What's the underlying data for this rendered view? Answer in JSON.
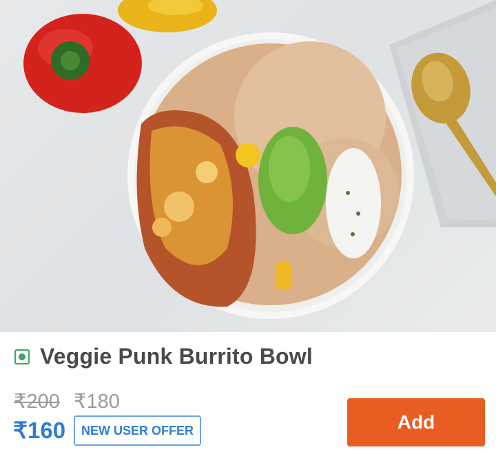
{
  "product": {
    "image_alt": "burrito-bowl-photo",
    "veg_indicator_color": "#3aa66a",
    "name": "Veggie Punk Burrito Bowl",
    "original_price": "₹200",
    "discounted_price": "₹180",
    "offer_price": "₹160",
    "offer_badge": "NEW USER OFFER",
    "add_label": "Add"
  },
  "colors": {
    "accent": "#ea5d22",
    "offer_blue": "#2f7dd6",
    "title": "#4a4a4a",
    "muted": "#9a9a9a"
  }
}
